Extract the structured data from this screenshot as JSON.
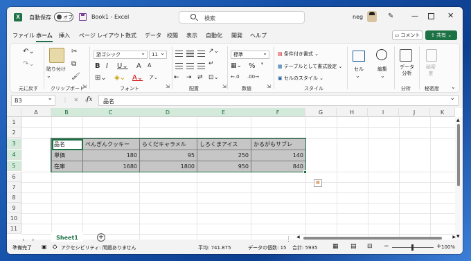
{
  "titlebar": {
    "logo": "X",
    "autosave_label": "自動保存",
    "autosave_state": "オフ",
    "doc_title": "Book1  -  Excel",
    "search_placeholder": "検索",
    "user_name": "neg"
  },
  "menu": {
    "tabs": [
      "ファイル",
      "ホーム",
      "挿入",
      "ページ レイアウト",
      "数式",
      "データ",
      "校閲",
      "表示",
      "自動化",
      "開発",
      "ヘルプ"
    ],
    "active_tab": "ホーム",
    "comment_label": "コメント",
    "share_label": "共有"
  },
  "ribbon": {
    "undo_group": "元に戻す",
    "clipboard": {
      "paste_label": "貼り付け",
      "group": "クリップボード"
    },
    "font": {
      "name": "游ゴシック",
      "size": "11",
      "group": "フォント"
    },
    "alignment": {
      "group": "配置"
    },
    "number": {
      "format": "標準",
      "group": "数値"
    },
    "styles": {
      "conditional": "条件付き書式",
      "as_table": "テーブルとして書式設定",
      "cell_styles": "セルのスタイル",
      "group": "スタイル"
    },
    "cells": {
      "label": "セル"
    },
    "editing": {
      "label": "編集"
    },
    "analysis": {
      "label": "データ\n分析",
      "group": "分析"
    },
    "sensitivity": {
      "label": "秘密\n度",
      "group": "秘密度"
    }
  },
  "formula_bar": {
    "name_box": "B3",
    "fx": "fx",
    "content": "品名"
  },
  "grid": {
    "columns": [
      "A",
      "B",
      "C",
      "D",
      "E",
      "F",
      "G",
      "H",
      "I",
      "J",
      "K"
    ],
    "rows": [
      "1",
      "2",
      "3",
      "4",
      "5",
      "6",
      "7",
      "8",
      "9",
      "10",
      "11"
    ],
    "table": {
      "header": [
        "品名",
        "ぺんぎんクッキー",
        "らくだキャラメル",
        "しろくまアイス",
        "かるがもサブレ"
      ],
      "rows": [
        [
          "単価",
          "180",
          "95",
          "250",
          "140"
        ],
        [
          "在庫",
          "1680",
          "1800",
          "950",
          "840"
        ]
      ]
    }
  },
  "sheets": {
    "active": "Sheet1"
  },
  "status": {
    "ready": "準備完了",
    "accessibility": "アクセシビリティ: 問題ありません",
    "average": "平均: 741.875",
    "count": "データの個数: 15",
    "sum": "合計: 5935",
    "zoom": "100%"
  }
}
